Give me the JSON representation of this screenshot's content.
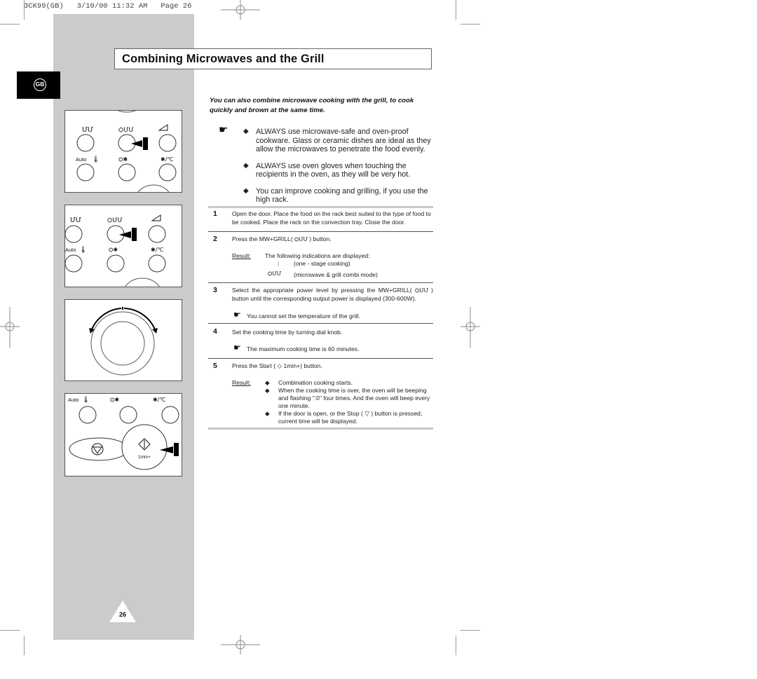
{
  "header": {
    "print_slug": "3CK99(GB)   3/10/00 11:32 AM   Page 26"
  },
  "language_tab": {
    "label": "GB"
  },
  "title": "Combining Microwaves and the Grill",
  "intro": "You can also combine microwave cooking with the grill, to cook quickly and brown at the same time.",
  "notes": {
    "icon": "pointing-hand-icon",
    "bullets": [
      "ALWAYS use microwave-safe and oven-proof cookware. Glass or ceramic dishes are ideal as they allow the microwaves to penetrate the food evenly.",
      "ALWAYS use oven gloves when touching the recipients in the oven, as they will be very hot.",
      "You can improve cooking and grilling, if you use the high rack."
    ]
  },
  "steps": [
    {
      "num": "1",
      "text": "Open the door. Place the food on the rack best suited to the type of food to be cooked. Place the rack on the convection tray. Close the door."
    },
    {
      "num": "2",
      "text_before": "Press the MW+GRILL(",
      "text_after": ") button.",
      "result_label": "Result:",
      "result_intro": "The following indications are displayed:",
      "indications": [
        {
          "symbol": "|",
          "text": "(one - stage cooking)"
        },
        {
          "symbol": "grill-microwave-icon",
          "text": "(microwave & grill combi mode)"
        }
      ]
    },
    {
      "num": "3",
      "text_before": "Select the appropriate power level by pressing the MW+GRILL(",
      "text_after": ") button until the corresponding output power is displayed (300-600W).",
      "note": "You cannot set the temperature of the grill."
    },
    {
      "num": "4",
      "text": "Set the cooking time by turning dial knob.",
      "note": "The maximum cooking time is 60 minutes."
    },
    {
      "num": "5",
      "text_before": "Press the Start (",
      "text_after": "1min+)  button.",
      "result_label": "Result:",
      "results": [
        "Combination cooking starts.",
        "When the cooking time is over, the oven will be beeping and flashing \":0\" four times. And the oven will beep every one minute.",
        "If the door is open, or the Stop (",
        "current time will be displayed."
      ],
      "result3_after": ") button is pressed,"
    }
  ],
  "panel_labels": {
    "auto": "Auto",
    "temp_unit": "/℃",
    "start_sub": "1min+"
  },
  "page_number": "26"
}
